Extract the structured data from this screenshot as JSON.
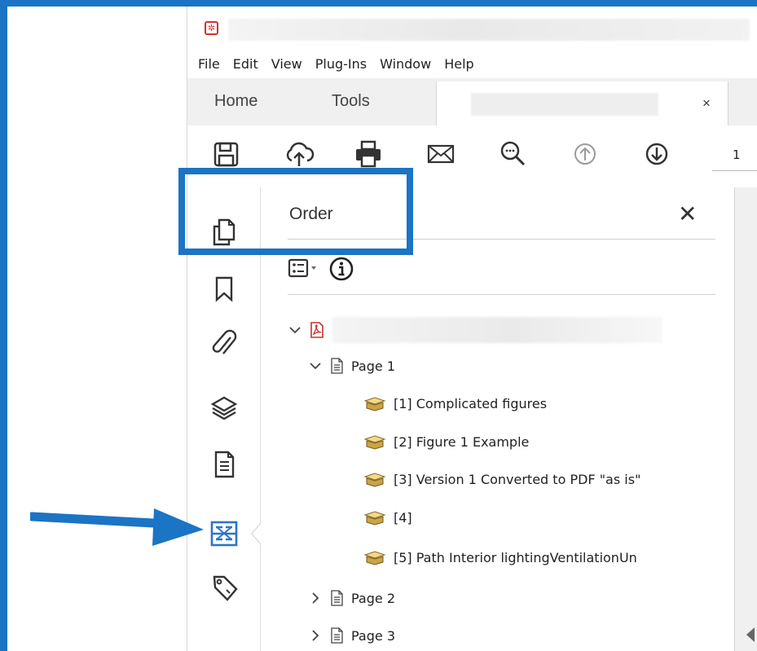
{
  "window": {
    "logo_icon": "acrobat-icon"
  },
  "menu": [
    "File",
    "Edit",
    "View",
    "Plug-Ins",
    "Window",
    "Help"
  ],
  "tabs": {
    "home": "Home",
    "tools": "Tools",
    "close": "×"
  },
  "toolbar": {
    "icons": [
      "save-icon",
      "cloud-upload-icon",
      "print-icon",
      "email-icon",
      "zoom-search-icon",
      "previous-page-icon",
      "next-page-icon"
    ],
    "page_number": "1"
  },
  "rail": {
    "icons": [
      "pages-icon",
      "bookmark-icon",
      "attachment-icon",
      "layers-icon",
      "page-thumbnail-icon",
      "order-icon",
      "tags-icon"
    ]
  },
  "panel": {
    "title": "Order",
    "close": "✕",
    "tree": {
      "pages": [
        {
          "label": "Page 1",
          "expanded": true
        },
        {
          "label": "Page 2",
          "expanded": false
        },
        {
          "label": "Page 3",
          "expanded": false
        }
      ],
      "items": [
        "[1]  Complicated figures",
        "[2]  Figure 1 Example",
        "[3]  Version 1 Converted to PDF \"as is\"",
        "[4]",
        "[5]  Path Interior lightingVentilationUn"
      ]
    }
  },
  "colors": {
    "highlight": "#1b74c4",
    "acrobat_red": "#d7312a",
    "order_icon": "#2d74c8"
  }
}
